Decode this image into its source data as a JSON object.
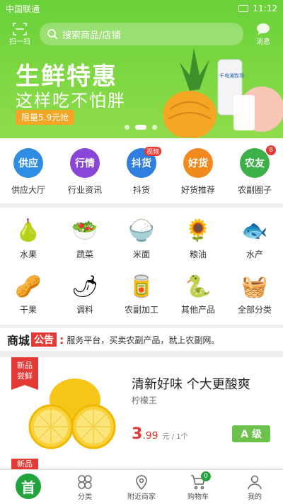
{
  "status": {
    "carrier": "中国联通",
    "time": "11:12"
  },
  "header": {
    "scan_label": "扫一扫",
    "search_placeholder": "搜索商品/店铺",
    "message_label": "消息"
  },
  "banner": {
    "title": "生鲜特惠",
    "subtitle": "这样吃不怕胖",
    "tag": "限量5.9元抢",
    "carton_text": "千岛湖牧场"
  },
  "quick": [
    {
      "icon": "供应",
      "label": "供应大厅",
      "color": "#2f8de4"
    },
    {
      "icon": "行情",
      "label": "行业资讯",
      "color": "#8a46d6"
    },
    {
      "icon": "抖货",
      "label": "抖货",
      "color": "#2f7ee0",
      "badge": "视频"
    },
    {
      "icon": "好货",
      "label": "好货推荐",
      "color": "#f08a1f"
    },
    {
      "icon": "农友",
      "label": "农副圈子",
      "color": "#3eb04a",
      "count": "8"
    }
  ],
  "categories": [
    {
      "label": "水果",
      "icon": "🍐",
      "icon_name": "pear-icon"
    },
    {
      "label": "蔬菜",
      "icon": "🥗",
      "icon_name": "vegetables-icon"
    },
    {
      "label": "米面",
      "icon": "🍚",
      "icon_name": "rice-icon"
    },
    {
      "label": "粮油",
      "icon": "🌻",
      "icon_name": "oil-icon"
    },
    {
      "label": "水产",
      "icon": "🐟",
      "icon_name": "fish-icon"
    },
    {
      "label": "干果",
      "icon": "🥜",
      "icon_name": "nuts-icon"
    },
    {
      "label": "调料",
      "icon": "🌶",
      "icon_name": "spice-icon"
    },
    {
      "label": "农副加工",
      "icon": "🥫",
      "icon_name": "processed-food-icon"
    },
    {
      "label": "其他产品",
      "icon": "🐍",
      "icon_name": "python-icon"
    },
    {
      "label": "全部分类",
      "icon": "🧺",
      "icon_name": "basket-icon"
    }
  ],
  "notice": {
    "brand": "商城",
    "tag": "公告",
    "text": "服务平台，买卖农副产品，就上农副网。"
  },
  "product": {
    "tag_line1": "新品",
    "tag_line2": "尝鲜",
    "title": "清新好味 个大更酸爽",
    "subtitle": "柠檬王",
    "price_int": "3",
    "price_dec": ".99",
    "unit": "元 / 1个",
    "grade": "A 级"
  },
  "next_tag": "新品",
  "tabbar": [
    {
      "label": "首",
      "name": "tab-home"
    },
    {
      "label": "分类",
      "name": "tab-category"
    },
    {
      "label": "附近商家",
      "name": "tab-nearby"
    },
    {
      "label": "购物车",
      "name": "tab-cart",
      "badge": "0"
    },
    {
      "label": "我的",
      "name": "tab-mine"
    }
  ]
}
